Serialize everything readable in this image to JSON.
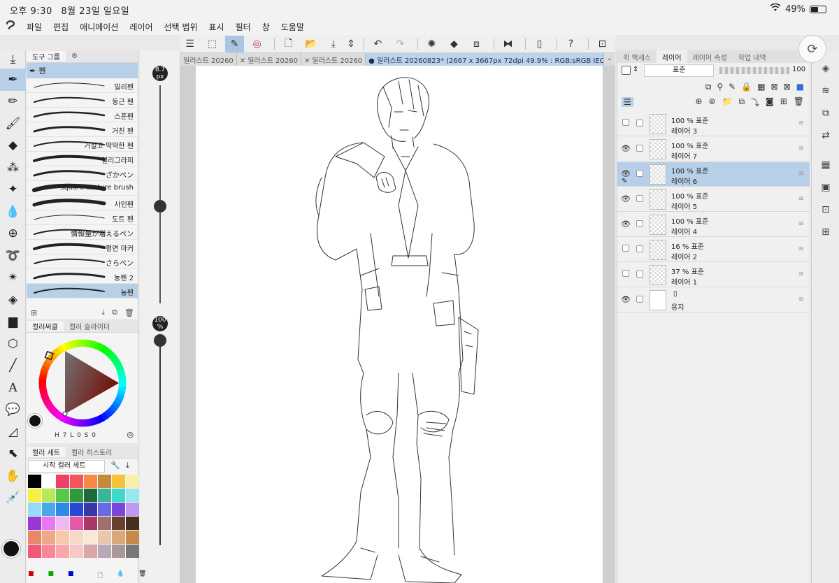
{
  "status": {
    "time": "오후 9:30",
    "date": "8월 23일 일요일",
    "battery": "49%",
    "battery_fraction": 0.49
  },
  "menu": [
    "파일",
    "편집",
    "애니메이션",
    "레이어",
    "선택 범위",
    "표시",
    "필터",
    "창",
    "도움말"
  ],
  "tabs": {
    "items": [
      "일러스트 20260",
      "일러스트 20260",
      "일러스트 20260"
    ],
    "active": "● 일러스트 20260823* (2667 x 3667px 72dpi 49.9% : RGB:sRGB IEC61966-2.1)"
  },
  "subtool": {
    "panel_tab": "도구 그룹",
    "group_label": "펜",
    "brushes": [
      "밀리펜",
      "둥근 펜",
      "스푼펜",
      "거친 펜",
      "거칠고 딱딱한 펜",
      "캘리그라피",
      "ざかペン",
      "square texture brush",
      "사인펜",
      "도트 펜",
      "情報量が増えるペン",
      "평면 마커",
      "さらペン",
      "농펜 2",
      "농펜"
    ],
    "active_index": 14
  },
  "size": {
    "brush_size": "8.7",
    "unit": "px",
    "opacity": "100",
    "opacity_unit": "%"
  },
  "color_circle": {
    "tab_active": "컬러써클",
    "tab_inactive": "컬러 슬라이더",
    "readout": "H 7  L 0  S 0",
    "current_color": "#111111"
  },
  "color_set": {
    "tab_active": "컬러 세트",
    "tab_inactive": "컬러 히스토리",
    "set_name": "시작 컬러 세트",
    "swatches": [
      "#000000",
      "#ffffff",
      "#f0406a",
      "#f5555a",
      "#f58a48",
      "#c58a3a",
      "#f5c23a",
      "#f8f0a8",
      "#f5f040",
      "#b8e858",
      "#58c848",
      "#2e9a3a",
      "#1e6a3a",
      "#38b898",
      "#40d8c8",
      "#98e8f0",
      "#98d8f8",
      "#48a8e8",
      "#3088e8",
      "#2848d8",
      "#3838a8",
      "#6868e8",
      "#7848d8",
      "#c098f0",
      "#9838d8",
      "#e878f0",
      "#f0b8f0",
      "#e858a8",
      "#a83868",
      "#a07070",
      "#6a4030",
      "#443020",
      "#e88868",
      "#f0a888",
      "#f8c8a8",
      "#f8d8c8",
      "#f8e8d8",
      "#e8c8a8",
      "#d8a878",
      "#c88848",
      "#f05878",
      "#f88898",
      "#f8a8a8",
      "#f8c8c8",
      "#d8a8a8",
      "#b8a8b8",
      "#a89898",
      "#787878"
    ]
  },
  "layer_panel": {
    "tabs": [
      "퀵 액세스",
      "레이어",
      "레이어 속성",
      "작업 내역"
    ],
    "blend_mode": "표준",
    "opacity": "100",
    "layers": [
      {
        "opacity_mode": "100 % 표준",
        "name": "레이어 3",
        "visible": false,
        "active": false,
        "paper": false
      },
      {
        "opacity_mode": "100 % 표준",
        "name": "레이어 7",
        "visible": true,
        "active": false,
        "paper": false
      },
      {
        "opacity_mode": "100 % 표준",
        "name": "레이어 6",
        "visible": true,
        "active": true,
        "paper": false
      },
      {
        "opacity_mode": "100 % 표준",
        "name": "레이어 5",
        "visible": true,
        "active": false,
        "paper": false
      },
      {
        "opacity_mode": "100 % 표준",
        "name": "레이어 4",
        "visible": true,
        "active": false,
        "paper": false
      },
      {
        "opacity_mode": "16 % 표준",
        "name": "레이어 2",
        "visible": false,
        "active": false,
        "paper": false
      },
      {
        "opacity_mode": "37 % 표준",
        "name": "레이어 1",
        "visible": false,
        "active": false,
        "paper": false
      },
      {
        "opacity_mode": "",
        "name": "용지",
        "visible": true,
        "active": false,
        "paper": true
      }
    ]
  }
}
